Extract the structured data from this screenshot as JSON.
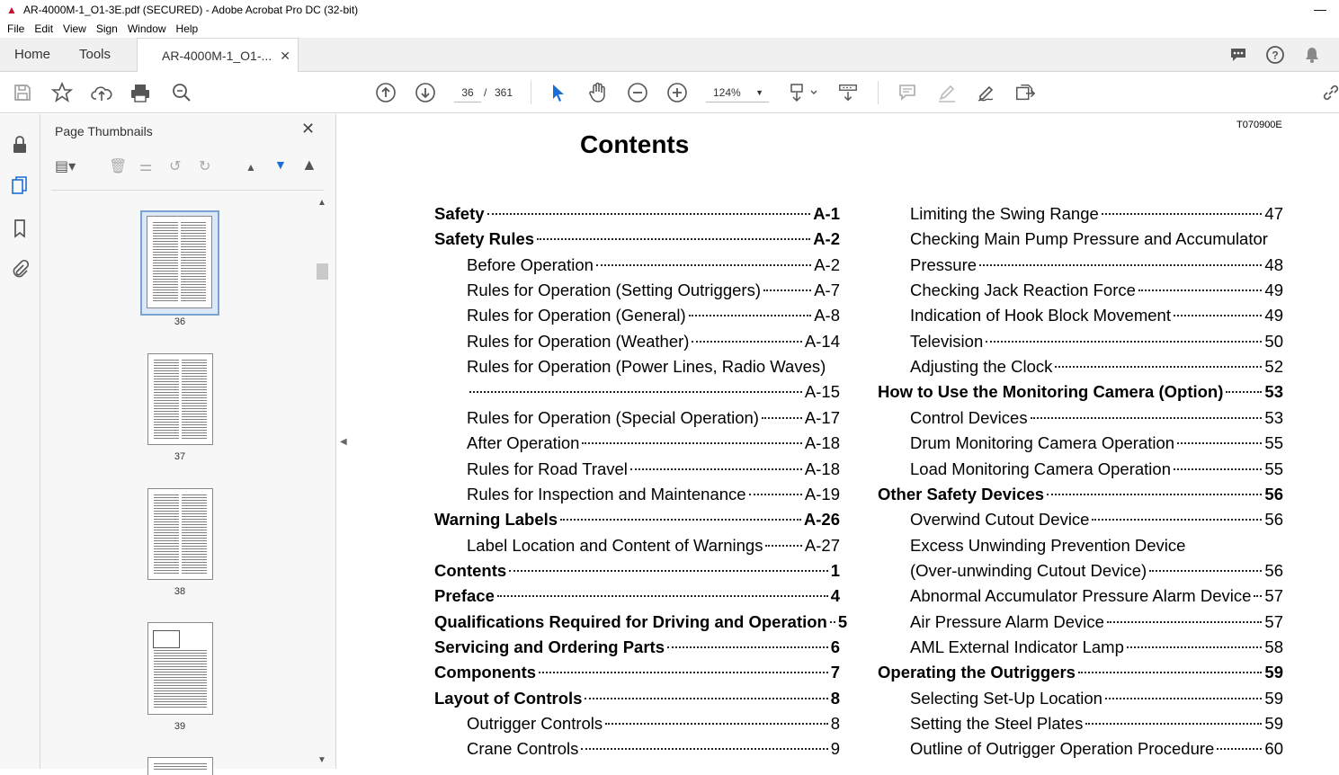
{
  "window": {
    "title": "AR-4000M-1_O1-3E.pdf (SECURED) - Adobe Acrobat Pro DC (32-bit)"
  },
  "menu": [
    "File",
    "Edit",
    "View",
    "Sign",
    "Window",
    "Help"
  ],
  "tabs": {
    "home": "Home",
    "tools": "Tools",
    "document": "AR-4000M-1_O1-..."
  },
  "toolbar": {
    "current_page": "36",
    "separator": "/",
    "total_pages": "361",
    "zoom": "124%"
  },
  "thumbnails_panel": {
    "title": "Page Thumbnails",
    "pages": [
      "36",
      "37",
      "38",
      "39"
    ]
  },
  "document": {
    "code": "T070900E",
    "title": "Contents",
    "left_column": [
      {
        "text": "Safety",
        "page": "A-1",
        "bold": true,
        "indent": false
      },
      {
        "text": "Safety Rules",
        "page": "A-2",
        "bold": true,
        "indent": false
      },
      {
        "text": "Before Operation",
        "page": "A-2",
        "bold": false,
        "indent": true
      },
      {
        "text": "Rules for Operation (Setting Outriggers)",
        "page": "A-7",
        "bold": false,
        "indent": true
      },
      {
        "text": "Rules for Operation (General)",
        "page": "A-8",
        "bold": false,
        "indent": true
      },
      {
        "text": "Rules for Operation (Weather)",
        "page": "A-14",
        "bold": false,
        "indent": true
      },
      {
        "text": "Rules for Operation (Power Lines, Radio Waves)",
        "page": "",
        "bold": false,
        "indent": true
      },
      {
        "text": "",
        "page": "A-15",
        "bold": false,
        "indent": true
      },
      {
        "text": "Rules for Operation (Special Operation)",
        "page": "A-17",
        "bold": false,
        "indent": true
      },
      {
        "text": "After Operation",
        "page": "A-18",
        "bold": false,
        "indent": true
      },
      {
        "text": "Rules for Road Travel",
        "page": "A-18",
        "bold": false,
        "indent": true
      },
      {
        "text": "Rules for Inspection and Maintenance",
        "page": "A-19",
        "bold": false,
        "indent": true
      },
      {
        "text": "Warning Labels",
        "page": "A-26",
        "bold": true,
        "indent": false
      },
      {
        "text": "Label Location and Content of Warnings",
        "page": "A-27",
        "bold": false,
        "indent": true
      },
      {
        "text": "Contents",
        "page": "1",
        "bold": true,
        "indent": false
      },
      {
        "text": "Preface",
        "page": "4",
        "bold": true,
        "indent": false
      },
      {
        "text": "Qualifications Required for Driving and Operation",
        "page": "5",
        "bold": true,
        "indent": false
      },
      {
        "text": "Servicing and Ordering Parts",
        "page": "6",
        "bold": true,
        "indent": false
      },
      {
        "text": "Components",
        "page": "7",
        "bold": true,
        "indent": false
      },
      {
        "text": "Layout of Controls",
        "page": "8",
        "bold": true,
        "indent": false
      },
      {
        "text": "Outrigger Controls",
        "page": "8",
        "bold": false,
        "indent": true
      },
      {
        "text": "Crane Controls",
        "page": "9",
        "bold": false,
        "indent": true
      }
    ],
    "right_column": [
      {
        "text": "Limiting the Swing Range",
        "page": "47",
        "bold": false,
        "indent": true
      },
      {
        "text": "Checking Main Pump Pressure and Accumulator",
        "page": "",
        "bold": false,
        "indent": true
      },
      {
        "text": "Pressure",
        "page": "48",
        "bold": false,
        "indent": true
      },
      {
        "text": "Checking Jack Reaction Force",
        "page": "49",
        "bold": false,
        "indent": true
      },
      {
        "text": "Indication of Hook Block Movement",
        "page": "49",
        "bold": false,
        "indent": true
      },
      {
        "text": "Television",
        "page": "50",
        "bold": false,
        "indent": true
      },
      {
        "text": "Adjusting the Clock",
        "page": "52",
        "bold": false,
        "indent": true
      },
      {
        "text": "How to Use the Monitoring Camera (Option)",
        "page": "53",
        "bold": true,
        "indent": false
      },
      {
        "text": "Control Devices",
        "page": "53",
        "bold": false,
        "indent": true
      },
      {
        "text": "Drum Monitoring Camera Operation",
        "page": "55",
        "bold": false,
        "indent": true
      },
      {
        "text": "Load Monitoring Camera Operation",
        "page": "55",
        "bold": false,
        "indent": true
      },
      {
        "text": "Other Safety Devices",
        "page": "56",
        "bold": true,
        "indent": false
      },
      {
        "text": "Overwind Cutout Device",
        "page": "56",
        "bold": false,
        "indent": true
      },
      {
        "text": "Excess Unwinding Prevention Device",
        "page": "",
        "bold": false,
        "indent": true
      },
      {
        "text": "(Over-unwinding Cutout Device)",
        "page": "56",
        "bold": false,
        "indent": true
      },
      {
        "text": "Abnormal Accumulator Pressure Alarm Device",
        "page": "57",
        "bold": false,
        "indent": true
      },
      {
        "text": "Air Pressure Alarm Device",
        "page": "57",
        "bold": false,
        "indent": true
      },
      {
        "text": "AML External Indicator Lamp",
        "page": "58",
        "bold": false,
        "indent": true
      },
      {
        "text": "Operating the Outriggers",
        "page": "59",
        "bold": true,
        "indent": false
      },
      {
        "text": "Selecting Set-Up Location",
        "page": "59",
        "bold": false,
        "indent": true
      },
      {
        "text": "Setting the Steel Plates",
        "page": "59",
        "bold": false,
        "indent": true
      },
      {
        "text": "Outline of Outrigger Operation Procedure",
        "page": "60",
        "bold": false,
        "indent": true
      }
    ]
  }
}
